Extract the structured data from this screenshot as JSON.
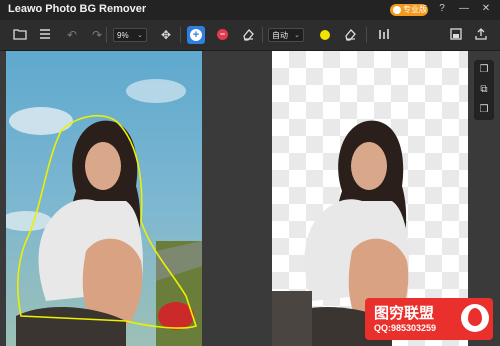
{
  "app": {
    "title": "Leawo Photo BG Remover"
  },
  "titlebar": {
    "pro_label": "专业版"
  },
  "toolbar": {
    "zoom_value": "9%",
    "mode_value": "自动",
    "brush_color": "#f2e200"
  },
  "watermark": {
    "title": "图穷联盟",
    "qq": "QQ:985303259"
  },
  "icons": [
    "folder-icon",
    "menu-icon",
    "undo-icon",
    "redo-icon",
    "move-icon",
    "keep-brush-icon",
    "remove-brush-icon",
    "eraser-icon",
    "color-icon",
    "eraser-icon",
    "adjust-icon",
    "save-icon",
    "share-icon",
    "help-icon",
    "minimize-icon",
    "close-icon",
    "layer-icon"
  ]
}
